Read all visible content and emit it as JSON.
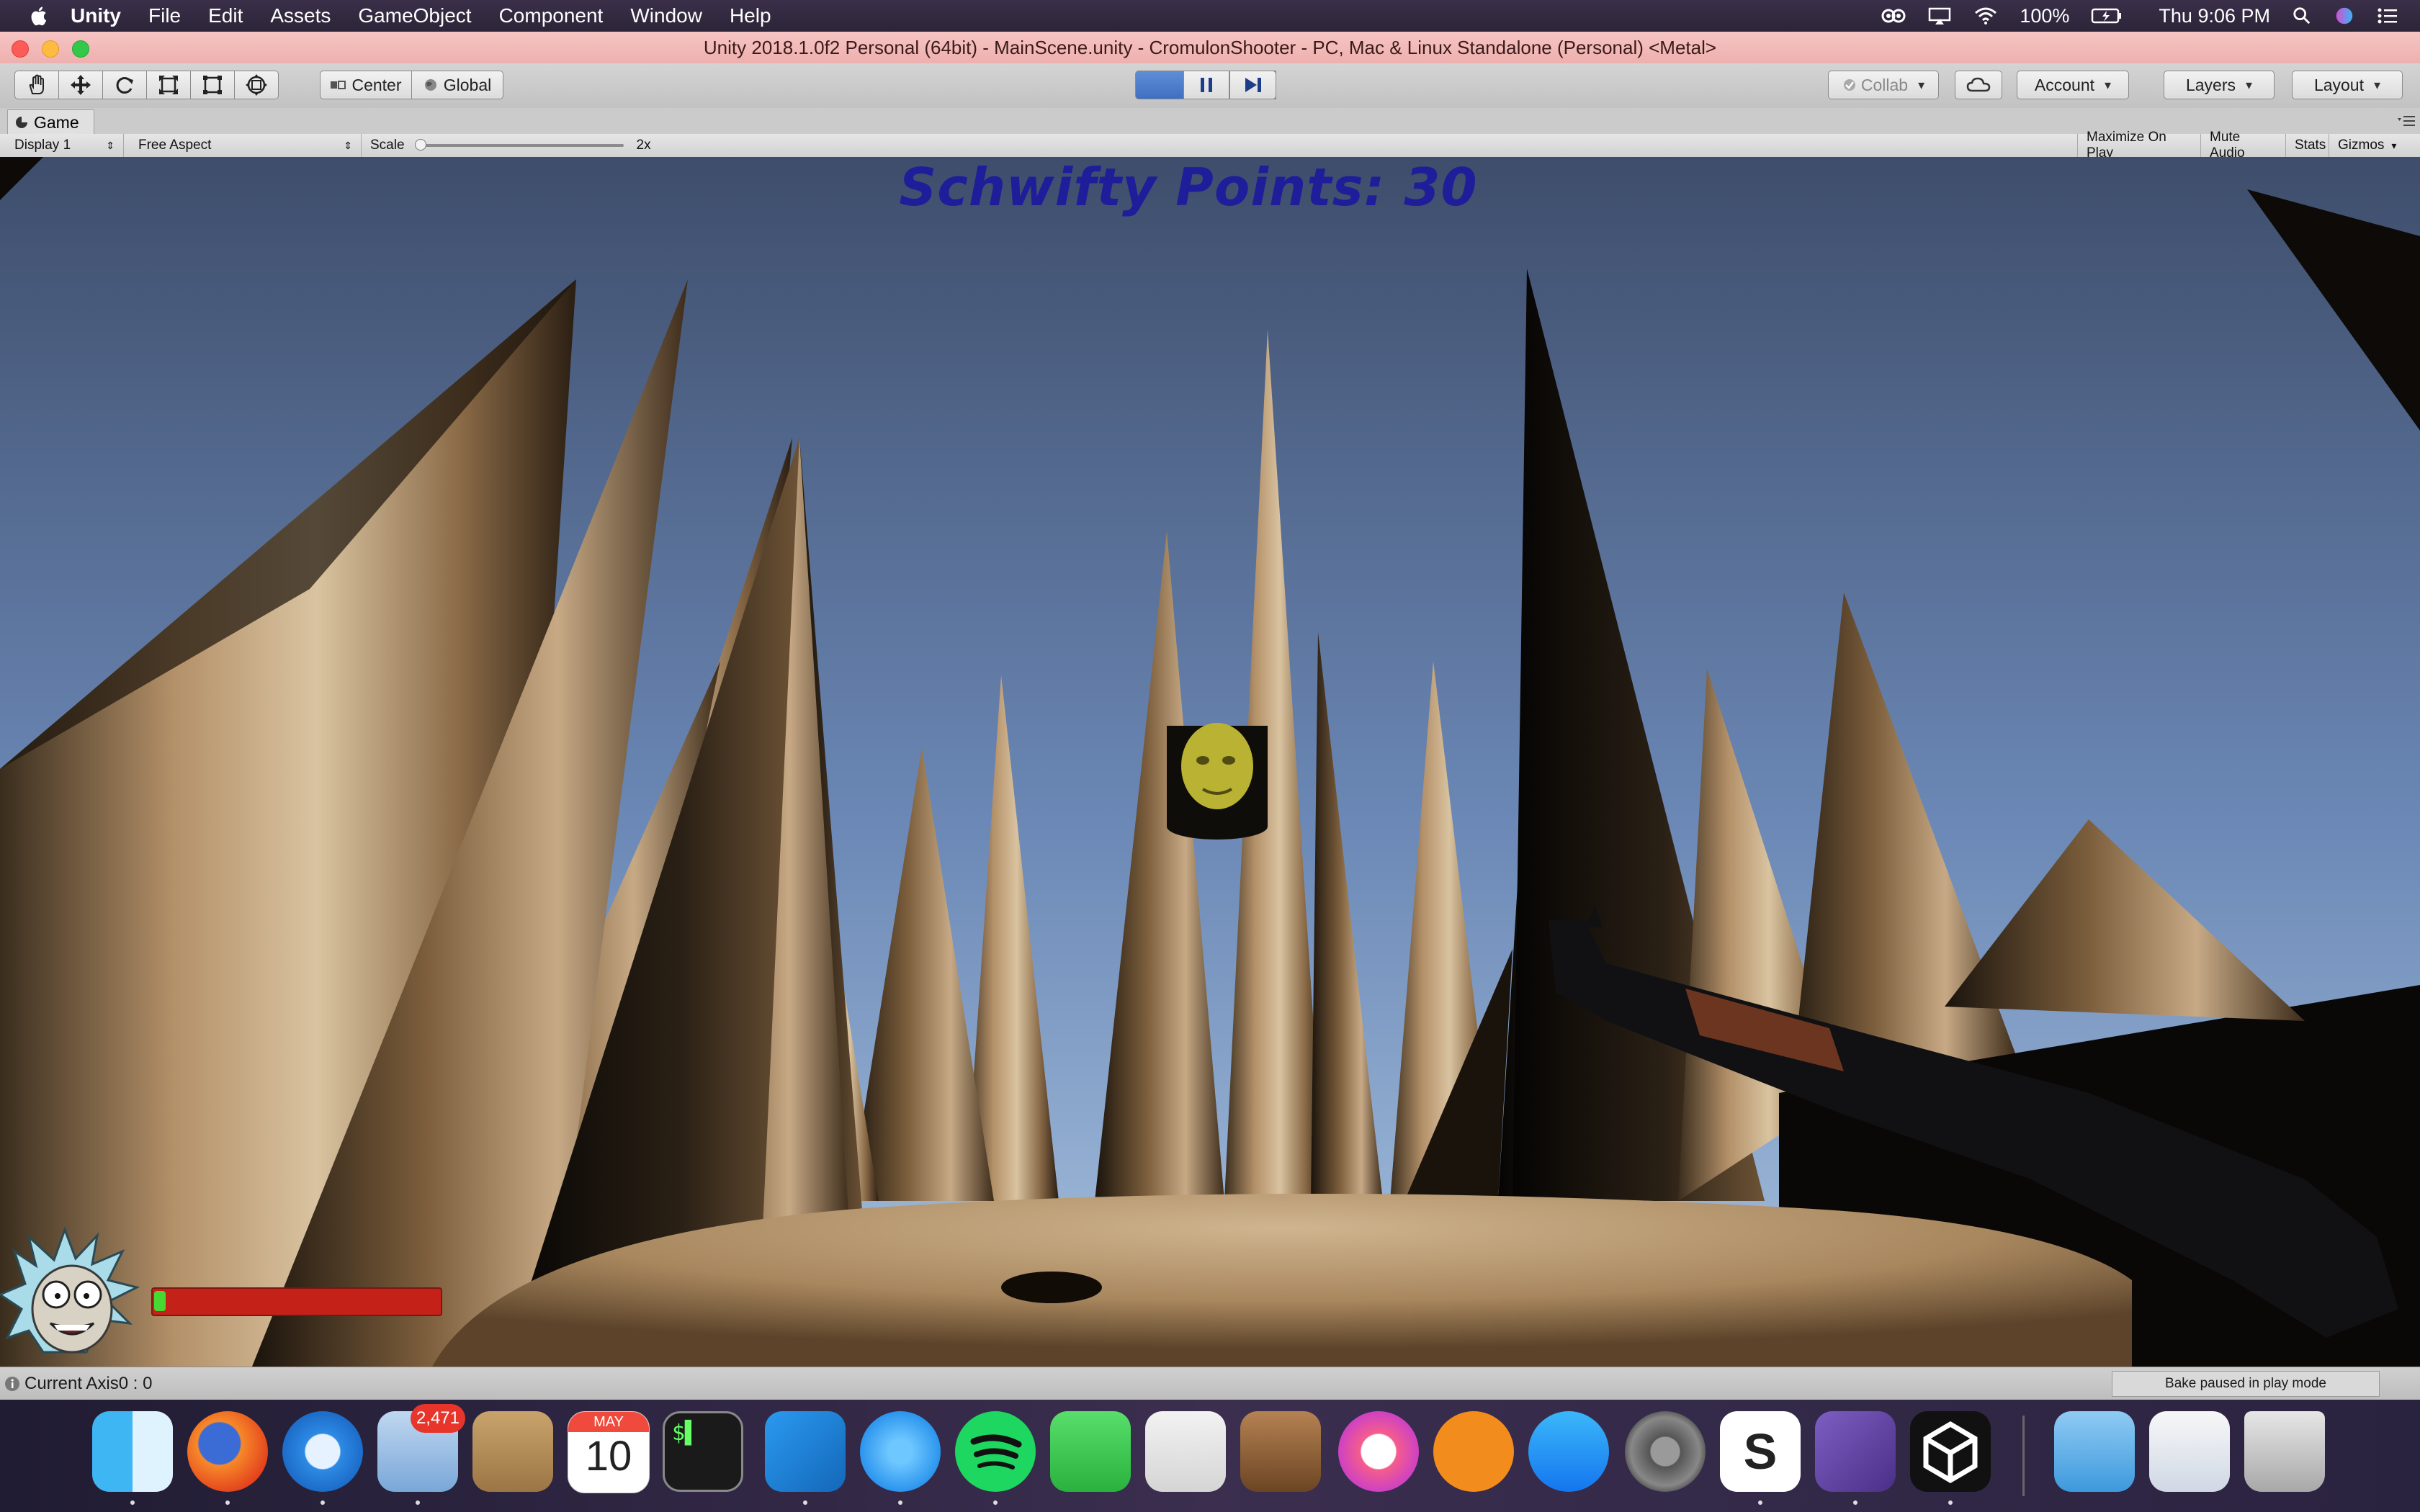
{
  "menubar": {
    "app_name": "Unity",
    "items": [
      "File",
      "Edit",
      "Assets",
      "GameObject",
      "Component",
      "Window",
      "Help"
    ],
    "battery": "100%",
    "clock": "Thu 9:06 PM"
  },
  "window": {
    "title": "Unity 2018.1.0f2 Personal (64bit) - MainScene.unity - CromulonShooter - PC, Mac & Linux Standalone (Personal) <Metal>"
  },
  "toolbar": {
    "tools": [
      "hand-icon",
      "move-icon",
      "rotate-icon",
      "scale-icon",
      "rect-icon",
      "transform-icon"
    ],
    "pivot_label": "Center",
    "space_label": "Global",
    "collab_label": "Collab",
    "account_label": "Account",
    "layers_label": "Layers",
    "layout_label": "Layout"
  },
  "game_panel": {
    "tab_label": "Game",
    "display": "Display 1",
    "aspect": "Free Aspect",
    "scale_label": "Scale",
    "scale_value": "2x",
    "scale_level": 0.0,
    "maximize_label": "Maximize On Play",
    "mute_label": "Mute Audio",
    "stats_label": "Stats",
    "gizmos_label": "Gizmos"
  },
  "hud": {
    "score_text": "Schwifty Points: 30",
    "health_fraction": 0.04
  },
  "status": {
    "message": "Current Axis0 : 0",
    "bake": "Bake paused in play mode"
  },
  "dock": {
    "mail_badge": "2,471",
    "calendar_month": "MAY",
    "calendar_day": "10",
    "apps": [
      "finder-icon",
      "firefox-icon",
      "safari-icon",
      "mail-icon",
      "contacts-icon",
      "calendar-icon",
      "terminal-icon",
      "vscode-icon",
      "messages-icon",
      "spotify-icon",
      "facetime-icon",
      "pages-icon",
      "garageband-icon",
      "itunes-icon",
      "books-icon",
      "appstore-icon",
      "system-preferences-icon",
      "slack-icon",
      "visual-studio-icon",
      "unity-icon",
      "downloads-folder-icon",
      "documents-stack-icon",
      "trash-icon"
    ]
  },
  "colors": {
    "score": "#1f1d9a",
    "health_bar": "#c42219",
    "health_fill": "#48d832",
    "sky_top": "#40506f",
    "sky_bottom": "#8eb1d8"
  }
}
